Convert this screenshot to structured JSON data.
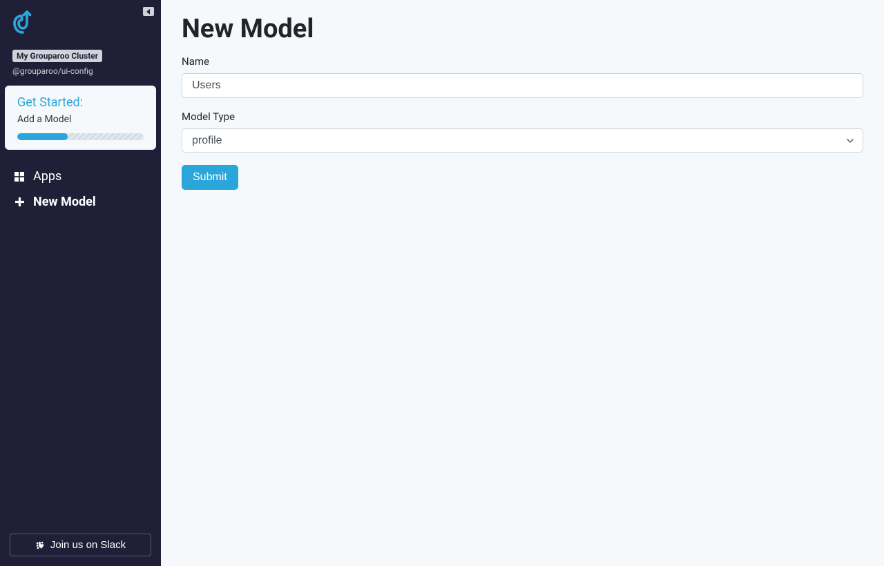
{
  "sidebar": {
    "cluster_name": "My Grouparoo Cluster",
    "package": "@grouparoo/ui-config",
    "get_started": {
      "title": "Get Started:",
      "step": "Add a Model",
      "progress_percent": 40
    },
    "nav": [
      {
        "icon": "grid",
        "label": "Apps",
        "active": false
      },
      {
        "icon": "plus",
        "label": "New Model",
        "active": true
      }
    ],
    "slack_label": "Join us on Slack"
  },
  "main": {
    "title": "New Model",
    "name_label": "Name",
    "name_value": "Users",
    "type_label": "Model Type",
    "type_value": "profile",
    "submit_label": "Submit"
  }
}
